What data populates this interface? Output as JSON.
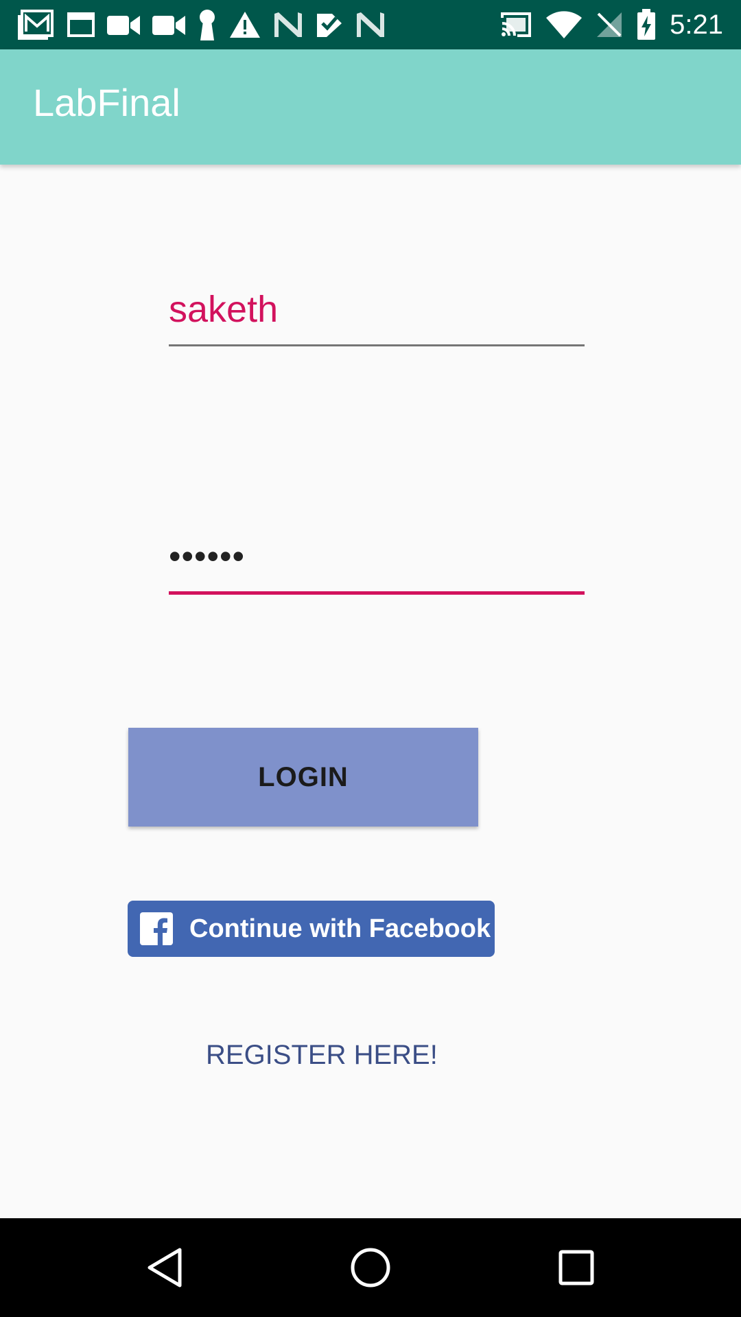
{
  "status_bar": {
    "time": "5:21",
    "icons_left": [
      "gmail-icon",
      "window-icon",
      "video-icon",
      "video-icon",
      "keyhole-icon",
      "warning-icon",
      "n-icon",
      "check-icon",
      "n-icon"
    ],
    "icons_right": [
      "cast-icon",
      "wifi-icon",
      "no-signal-icon",
      "battery-charging-icon"
    ]
  },
  "app_bar": {
    "title": "LabFinal",
    "color": "#80d5ca"
  },
  "form": {
    "username_value": "saketh",
    "password_value": "••••••",
    "login_label": "LOGIN",
    "facebook_label": "Continue with Facebook",
    "register_label": "REGISTER HERE!"
  },
  "colors": {
    "status_bar": "#00574b",
    "accent": "#d2125d",
    "login_button": "#7f91cb",
    "facebook": "#4267b2"
  },
  "nav_bar": {
    "icons": [
      "back-icon",
      "home-icon",
      "recents-icon"
    ]
  }
}
